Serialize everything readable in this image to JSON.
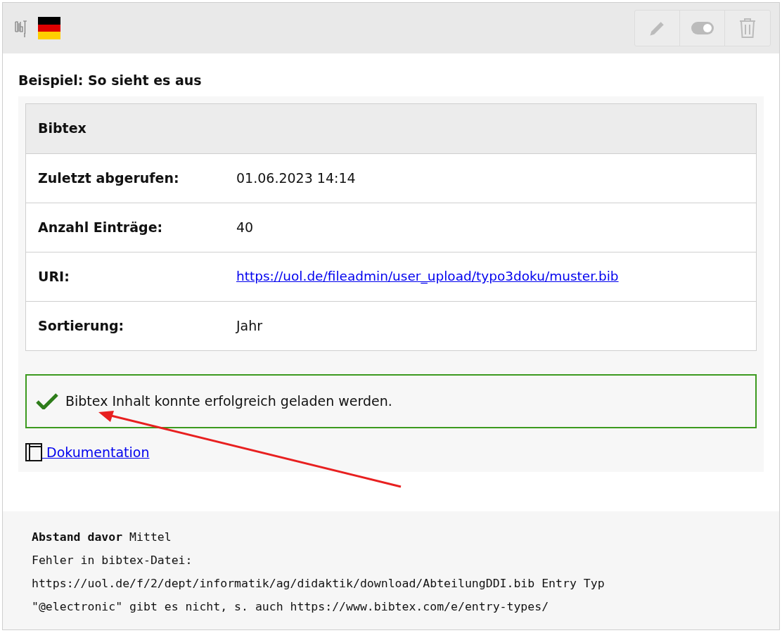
{
  "heading": "Beispiel: So sieht es aus",
  "table": {
    "title": "Bibtex",
    "rows": [
      {
        "label": "Zuletzt abgerufen:",
        "value": "01.06.2023 14:14",
        "kind": "text"
      },
      {
        "label": "Anzahl Einträge:",
        "value": "40",
        "kind": "text"
      },
      {
        "label": "URI:",
        "value": "https://uol.de/fileadmin/user_upload/typo3doku/muster.bib",
        "kind": "link"
      },
      {
        "label": "Sortierung:",
        "value": "Jahr",
        "kind": "text"
      }
    ]
  },
  "message": {
    "text": "Bibtex Inhalt konnte erfolgreich geladen werden.",
    "kind": "success"
  },
  "doc_link": " Dokumentation",
  "footer_lines": [
    "**Abstand davor** Mittel",
    "Fehler in bibtex-Datei:",
    "https://uol.de/f/2/dept/informatik/ag/didaktik/download/AbteilungDDI.bib Entry Typ",
    "\"@electronic\" gibt es nicht, s. auch https://www.bibtex.com/e/entry-types/"
  ]
}
